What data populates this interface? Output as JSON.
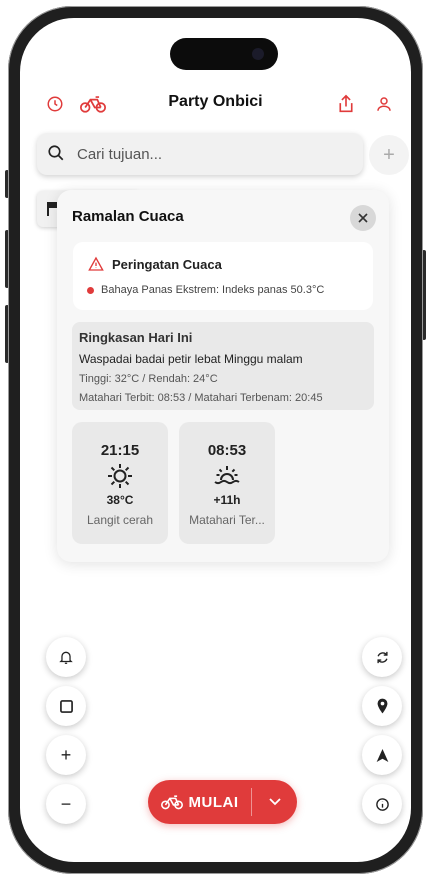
{
  "header": {
    "title": "Party Onbici",
    "left_icons": [
      "history-icon",
      "bike-icon"
    ],
    "right_icons": [
      "share-icon",
      "profile-icon"
    ],
    "accent_color": "#e03b3b"
  },
  "search": {
    "placeholder": "Cari tujuan...",
    "add_label": "+"
  },
  "weather": {
    "title": "Ramalan Cuaca",
    "warning": {
      "title": "Peringatan Cuaca",
      "message": "Bahaya Panas Ekstrem: Indeks panas 50.3°C"
    },
    "summary": {
      "title": "Ringkasan Hari Ini",
      "description": "Waspadai badai petir lebat Minggu malam",
      "temps": "Tinggi: 32°C / Rendah: 24°C",
      "sun": "Matahari Terbit: 08:53 / Matahari Terbenam: 20:45"
    },
    "hourly": [
      {
        "time": "21:15",
        "icon": "sun-icon",
        "value": "38°C",
        "label": "Langit cerah"
      },
      {
        "time": "08:53",
        "icon": "sunrise-icon",
        "value": "+11h",
        "label": "Matahari Ter..."
      }
    ]
  },
  "map_controls": {
    "left": [
      "bell-icon",
      "square-icon",
      "zoom-in-icon",
      "zoom-out-icon"
    ],
    "right": [
      "refresh-icon",
      "location-pin-icon",
      "navigation-arrow-icon",
      "info-icon"
    ],
    "zoom_in": "+",
    "zoom_out": "−"
  },
  "start_button": {
    "label": "MULAI",
    "icon": "bike-icon",
    "dropdown_icon": "chevron-down-icon"
  }
}
